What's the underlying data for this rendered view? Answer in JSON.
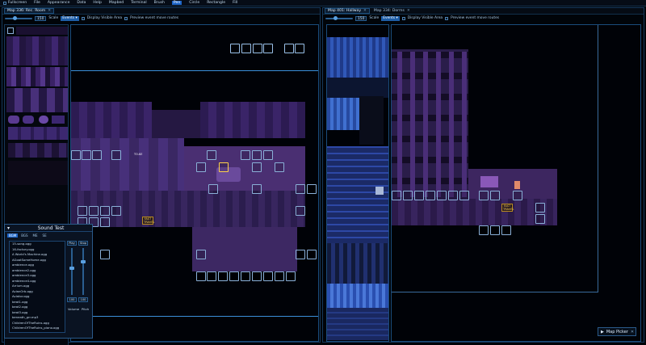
{
  "menubar": {
    "items": [
      {
        "label": "Fullscreen",
        "checkbox": true
      },
      {
        "label": "File"
      },
      {
        "label": "Appearance"
      },
      {
        "label": "Data"
      },
      {
        "label": "Help"
      },
      {
        "label": "Mapbed"
      },
      {
        "label": "Terminal"
      },
      {
        "label": "Brush"
      },
      {
        "label": "Pen",
        "active": true
      },
      {
        "label": "Circle"
      },
      {
        "label": "Rectangle"
      },
      {
        "label": "Fill"
      }
    ]
  },
  "left_pane": {
    "tab_label": "Map 336: Rec. Room",
    "zoom_value": "150",
    "scale_label": "Scale",
    "mode_dropdown": "Events",
    "display_visible_area": "Display Visible Area",
    "preview_event_move_routes": "Preview event move routes",
    "labels": {
      "tile_exit": "TO-KE",
      "fast_travel": "FAST TRAVEL"
    }
  },
  "right_pane": {
    "tabs": [
      {
        "label": "Map 401: Hallway",
        "active": true
      },
      {
        "label": "Map 334: Dorms",
        "active": false
      }
    ],
    "zoom_value": "150",
    "scale_label": "Scale",
    "mode_dropdown": "Events",
    "display_visible_area": "Display Visible Area",
    "preview_event_move_routes": "Preview event move routes",
    "labels": {
      "fast_travel": "FAST TRAVEL"
    }
  },
  "sound_test": {
    "title": "Sound Test",
    "tabs": [
      "BGM",
      "BGS",
      "ME",
      "SE"
    ],
    "active_tab": "BGM",
    "songs": [
      "15-song.ogg",
      "16-factory.ogg",
      "A World's Machine.ogg",
      "AGoatSomeHome.ogg",
      "ambience.ogg",
      "ambience2.ogg",
      "ambience3.ogg",
      "ambience4.ogg",
      "Arrium.ogg",
      "AvianOrb.ogg",
      "Aviator.ogg",
      "beat1.ogg",
      "beat2.ogg",
      "beat3.ogg",
      "beneath_grr.mp3",
      "ChildrenOfTheRuins.ogg",
      "ChildrenOfTheRuins_piano.ogg"
    ],
    "play_label": "Play",
    "stop_label": "Stop",
    "volume_value": "100",
    "pitch_value": "100",
    "volume_label": "Volume",
    "pitch_label": "Pitch",
    "volume_level_pct": 60,
    "pitch_level_pct": 75
  },
  "map_picker": {
    "label": "Map Picker"
  },
  "colors": {
    "accent": "#1e66c8",
    "ui_border": "#16385a",
    "floor_purple": "#4a2f72",
    "wall_purple": "#2c1b52"
  }
}
